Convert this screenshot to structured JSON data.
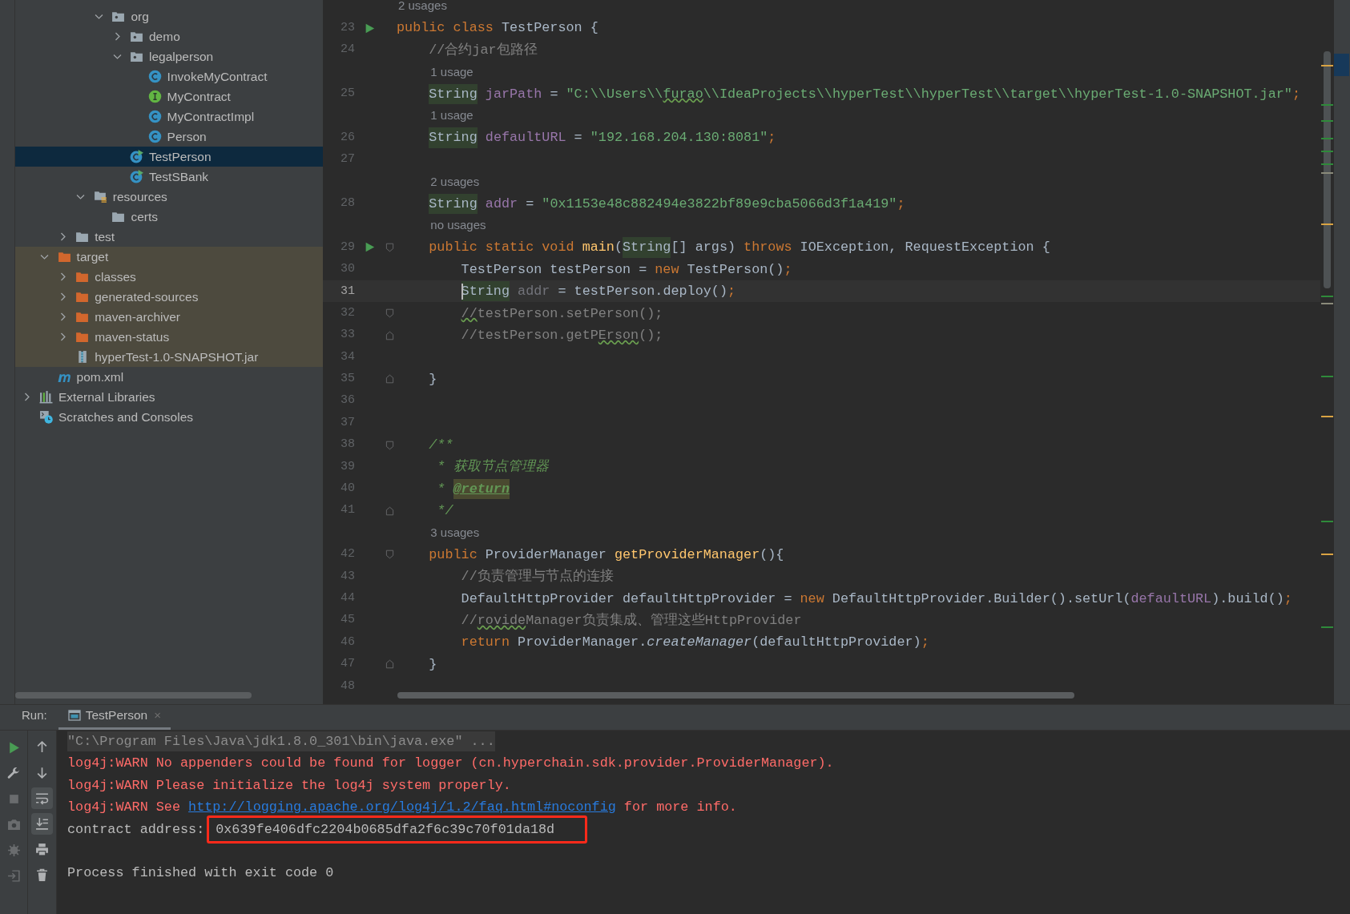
{
  "project_tree": [
    {
      "children": [
        {
          "children": [
            {
              "children": [
                {
                  "children": [
                    {
                      "label": "org",
                      "kind": "package",
                      "expanded": true,
                      "selected": false,
                      "children": [
                        {
                          "label": "demo",
                          "kind": "package",
                          "expanded": false,
                          "selected": false
                        },
                        {
                          "label": "legalperson",
                          "kind": "package",
                          "expanded": true,
                          "selected": false,
                          "children": [
                            {
                              "label": "InvokeMyContract",
                              "kind": "class",
                              "selected": false
                            },
                            {
                              "label": "MyContract",
                              "kind": "interface",
                              "selected": false
                            },
                            {
                              "label": "MyContractImpl",
                              "kind": "class",
                              "selected": false
                            },
                            {
                              "label": "Person",
                              "kind": "class",
                              "selected": false
                            }
                          ]
                        },
                        {
                          "label": "TestPerson",
                          "kind": "runnable",
                          "selected": true
                        },
                        {
                          "label": "TestSBank",
                          "kind": "runnable",
                          "selected": false
                        }
                      ]
                    }
                  ]
                },
                {
                  "label": "resources",
                  "kind": "resources",
                  "expanded": true,
                  "selected": false,
                  "children": [
                    {
                      "label": "certs",
                      "kind": "folder",
                      "selected": false
                    }
                  ]
                }
              ]
            },
            {
              "label": "test",
              "kind": "folder",
              "expanded": false,
              "selected": false
            }
          ]
        },
        {
          "label": "target",
          "kind": "folder",
          "excluded": true,
          "expanded": true,
          "selected": false,
          "children": [
            {
              "label": "classes",
              "kind": "folder",
              "excluded": true,
              "expanded": false,
              "selected": false
            },
            {
              "label": "generated-sources",
              "kind": "folder",
              "excluded": true,
              "expanded": false,
              "selected": false
            },
            {
              "label": "maven-archiver",
              "kind": "folder",
              "excluded": true,
              "expanded": false,
              "selected": false
            },
            {
              "label": "maven-status",
              "kind": "folder",
              "excluded": true,
              "expanded": false,
              "selected": false
            },
            {
              "label": "hyperTest-1.0-SNAPSHOT.jar",
              "kind": "archive",
              "excluded": true,
              "selected": false
            }
          ]
        },
        {
          "label": "pom.xml",
          "kind": "module",
          "selected": false
        }
      ]
    },
    {
      "label": "External Libraries",
      "kind": "libraries",
      "expanded": false,
      "selected": false
    },
    {
      "label": "Scratches and Consoles",
      "kind": "scratches",
      "selected": false
    }
  ],
  "editor": {
    "rows": [
      {
        "kind": "hint",
        "text": "2 usages"
      },
      {
        "kind": "line",
        "number": "23",
        "current": false,
        "runnable": true,
        "tokens": [
          {
            "kind": "kw",
            "text": "public class "
          },
          {
            "kind": "plain",
            "text": "TestPerson {"
          }
        ]
      },
      {
        "kind": "line",
        "number": "24",
        "current": false,
        "tokens": [
          {
            "kind": "comment",
            "text": "    //合约jar包路径"
          }
        ]
      },
      {
        "kind": "hint",
        "text": "1 usage"
      },
      {
        "kind": "line",
        "number": "25",
        "current": false,
        "tokens": [
          {
            "kind": "type",
            "text": "    String"
          },
          {
            "kind": "field",
            "text": " jarPath"
          },
          {
            "kind": "plain",
            "text": " = "
          },
          {
            "kind": "str",
            "text": "\"C:\\\\Users\\\\"
          },
          {
            "kind": "str",
            "text": "furao",
            "typo": true
          },
          {
            "kind": "str",
            "text": "\\\\IdeaProjects\\\\hyperTest\\\\hyperTest\\\\target\\\\hyperTest-1.0-SNAPSHOT.jar\""
          },
          {
            "kind": "semi",
            "text": ";"
          }
        ]
      },
      {
        "kind": "hint",
        "text": "1 usage"
      },
      {
        "kind": "line",
        "number": "26",
        "current": false,
        "tokens": [
          {
            "kind": "type",
            "text": "    String"
          },
          {
            "kind": "field",
            "text": " defaultURL"
          },
          {
            "kind": "plain",
            "text": " = "
          },
          {
            "kind": "str",
            "text": "\"192.168.204.130:8081\""
          },
          {
            "kind": "semi",
            "text": ";"
          }
        ]
      },
      {
        "kind": "line",
        "number": "27",
        "current": false,
        "tokens": []
      },
      {
        "kind": "hint",
        "text": "2 usages"
      },
      {
        "kind": "line",
        "number": "28",
        "current": false,
        "tokens": [
          {
            "kind": "type",
            "text": "    String"
          },
          {
            "kind": "field",
            "text": " addr"
          },
          {
            "kind": "plain",
            "text": " = "
          },
          {
            "kind": "str",
            "text": "\"0x1153e48c882494e3822bf89e9cba5066d3f1a419\""
          },
          {
            "kind": "semi",
            "text": ";"
          }
        ]
      },
      {
        "kind": "hint",
        "text": "no usages"
      },
      {
        "kind": "line",
        "number": "29",
        "current": false,
        "runnable": true,
        "fold_start": true,
        "tokens": [
          {
            "kind": "kw",
            "text": "    public static void "
          },
          {
            "kind": "fn",
            "text": "main"
          },
          {
            "kind": "plain",
            "text": "("
          },
          {
            "kind": "type",
            "text": "String"
          },
          {
            "kind": "plain",
            "text": "[] args) "
          },
          {
            "kind": "kw",
            "text": "throws "
          },
          {
            "kind": "plain",
            "text": "IOException, RequestException {"
          }
        ]
      },
      {
        "kind": "line",
        "number": "30",
        "current": false,
        "tokens": [
          {
            "kind": "plain",
            "text": "        TestPerson testPerson = "
          },
          {
            "kind": "kw",
            "text": "new "
          },
          {
            "kind": "plain",
            "text": "TestPerson()"
          },
          {
            "kind": "semi",
            "text": ";"
          }
        ]
      },
      {
        "kind": "line",
        "number": "31",
        "current": true,
        "tokens": [
          {
            "kind": "type",
            "text": "        String"
          },
          {
            "kind": "unused",
            "text": " addr"
          },
          {
            "kind": "plain",
            "text": " = testPerson.deploy()"
          },
          {
            "kind": "semi",
            "text": ";"
          }
        ]
      },
      {
        "kind": "line",
        "number": "32",
        "current": false,
        "fold_start": true,
        "tokens": [
          {
            "kind": "comment",
            "text": "        //",
            "typo": true
          },
          {
            "kind": "comment",
            "text": "testPerson.setPerson();"
          }
        ]
      },
      {
        "kind": "line",
        "number": "33",
        "current": false,
        "fold_end": true,
        "tokens": [
          {
            "kind": "comment",
            "text": "        //testPerson.getP"
          },
          {
            "kind": "comment",
            "text": "Erson",
            "typo": true
          },
          {
            "kind": "comment",
            "text": "();"
          }
        ]
      },
      {
        "kind": "line",
        "number": "34",
        "current": false,
        "tokens": []
      },
      {
        "kind": "line",
        "number": "35",
        "current": false,
        "fold_end": true,
        "tokens": [
          {
            "kind": "plain",
            "text": "    }"
          }
        ]
      },
      {
        "kind": "line",
        "number": "36",
        "current": false,
        "tokens": []
      },
      {
        "kind": "line",
        "number": "37",
        "current": false,
        "tokens": []
      },
      {
        "kind": "line",
        "number": "38",
        "current": false,
        "fold_start": true,
        "tokens": [
          {
            "kind": "doc",
            "text": "    /**"
          }
        ]
      },
      {
        "kind": "line",
        "number": "39",
        "current": false,
        "tokens": [
          {
            "kind": "doc",
            "text": "     * 获取节点管理器"
          }
        ]
      },
      {
        "kind": "line",
        "number": "40",
        "current": false,
        "tokens": [
          {
            "kind": "doc",
            "text": "     * "
          },
          {
            "kind": "doctag",
            "text": "@return"
          }
        ]
      },
      {
        "kind": "line",
        "number": "41",
        "current": false,
        "fold_end": true,
        "tokens": [
          {
            "kind": "doc",
            "text": "     */"
          }
        ]
      },
      {
        "kind": "hint",
        "text": "3 usages"
      },
      {
        "kind": "line",
        "number": "42",
        "current": false,
        "fold_start": true,
        "tokens": [
          {
            "kind": "kw",
            "text": "    public "
          },
          {
            "kind": "plain",
            "text": "ProviderManager "
          },
          {
            "kind": "fn",
            "text": "getProviderManager"
          },
          {
            "kind": "plain",
            "text": "(){"
          }
        ]
      },
      {
        "kind": "line",
        "number": "43",
        "current": false,
        "tokens": [
          {
            "kind": "comment",
            "text": "        //负责管理与节点的连接"
          }
        ]
      },
      {
        "kind": "line",
        "number": "44",
        "current": false,
        "tokens": [
          {
            "kind": "plain",
            "text": "        DefaultHttpProvider defaultHttpProvider = "
          },
          {
            "kind": "kw",
            "text": "new "
          },
          {
            "kind": "plain",
            "text": "DefaultHttpProvider.Builder().setUrl("
          },
          {
            "kind": "field",
            "text": "defaultURL"
          },
          {
            "kind": "plain",
            "text": ").build()"
          },
          {
            "kind": "semi",
            "text": ";"
          }
        ]
      },
      {
        "kind": "line",
        "number": "45",
        "current": false,
        "tokens": [
          {
            "kind": "comment",
            "text": "        //"
          },
          {
            "kind": "comment",
            "text": "rovide",
            "typo": true
          },
          {
            "kind": "comment",
            "text": "Manager负责集成、管理这些HttpProvider"
          }
        ]
      },
      {
        "kind": "line",
        "number": "46",
        "current": false,
        "tokens": [
          {
            "kind": "kw",
            "text": "        return "
          },
          {
            "kind": "plain",
            "text": "ProviderManager."
          },
          {
            "kind": "italic",
            "text": "createManager"
          },
          {
            "kind": "plain",
            "text": "(defaultHttpProvider)"
          },
          {
            "kind": "semi",
            "text": ";"
          }
        ]
      },
      {
        "kind": "line",
        "number": "47",
        "current": false,
        "fold_end": true,
        "tokens": [
          {
            "kind": "plain",
            "text": "    }"
          }
        ]
      },
      {
        "kind": "line",
        "number": "48",
        "current": false,
        "tokens": []
      }
    ]
  },
  "run_panel": {
    "label": "Run:",
    "tabs": [
      {
        "label": "TestPerson",
        "selected": true,
        "close": "×"
      }
    ],
    "tools_left": [
      {
        "kind": "rerun",
        "disabled": false
      },
      {
        "kind": "wrench",
        "disabled": false
      },
      {
        "kind": "stop",
        "disabled": true
      },
      {
        "kind": "camera",
        "disabled": true
      },
      {
        "kind": "bug",
        "disabled": true
      },
      {
        "kind": "exit",
        "disabled": true
      }
    ],
    "tools_right": [
      {
        "kind": "up",
        "on": false
      },
      {
        "kind": "down",
        "on": false
      },
      {
        "kind": "soft-wrap",
        "on": true
      },
      {
        "kind": "scroll-to-end",
        "on": true
      },
      {
        "kind": "print",
        "on": false
      },
      {
        "kind": "trash",
        "on": false
      }
    ],
    "console": [
      {
        "segments": [
          {
            "kind": "command",
            "text": "\"C:\\Program Files\\Java\\jdk1.8.0_301\\bin\\java.exe\" ..."
          }
        ]
      },
      {
        "segments": [
          {
            "kind": "error",
            "text": "log4j:WARN No appenders could be found for logger (cn.hyperchain.sdk.provider.ProviderManager)."
          }
        ]
      },
      {
        "segments": [
          {
            "kind": "error",
            "text": "log4j:WARN Please initialize the log4j system properly."
          }
        ]
      },
      {
        "segments": [
          {
            "kind": "error",
            "text": "log4j:WARN See "
          },
          {
            "kind": "link",
            "text": "http://logging.apache.org/log4j/1.2/faq.html#noconfig"
          },
          {
            "kind": "error",
            "text": " for more info."
          }
        ]
      },
      {
        "segments": [
          {
            "kind": "output",
            "text": "contract address:"
          },
          {
            "kind": "boxed",
            "text": "0x639fe406dfc2204b0685dfa2f6c39c70f01da18d"
          }
        ]
      },
      {
        "kind": "summary",
        "segments": [
          {
            "kind": "output",
            "text": "Process finished with exit code 0"
          }
        ]
      }
    ]
  }
}
